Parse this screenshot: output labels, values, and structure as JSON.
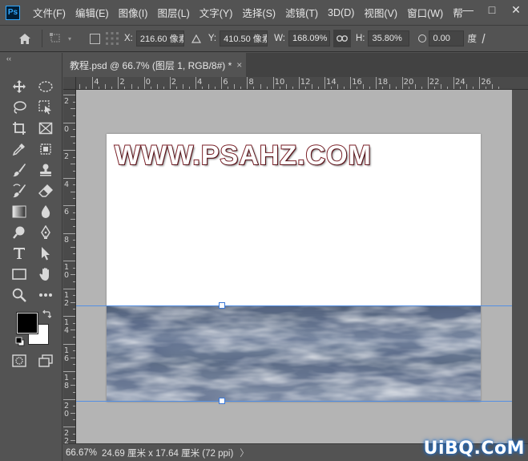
{
  "menubar": {
    "logo": "Ps",
    "items": [
      "文件(F)",
      "编辑(E)",
      "图像(I)",
      "图层(L)",
      "文字(Y)",
      "选择(S)",
      "滤镜(T)",
      "3D(D)",
      "视图(V)",
      "窗口(W)",
      "帮"
    ],
    "window_buttons": {
      "minimize": "—",
      "maximize": "□",
      "close": "✕"
    }
  },
  "options": {
    "x_label": "X:",
    "x_value": "216.60 像素",
    "y_label": "Y:",
    "y_value": "410.50 像素",
    "w_label": "W:",
    "w_value": "168.09%",
    "h_label": "H:",
    "h_value": "35.80%",
    "angle_value": "0.00",
    "angle_unit": "度"
  },
  "toolbar": {
    "collapse": "‹‹"
  },
  "tab": {
    "title": "教程.psd @ 66.7% (图层 1, RGB/8#) *",
    "close": "×"
  },
  "rulers": {
    "h_labels": [
      "6",
      "4",
      "2",
      "0",
      "2",
      "4",
      "6",
      "8",
      "10",
      "12",
      "14",
      "16",
      "18",
      "20",
      "22",
      "24",
      "26"
    ],
    "v_labels": [
      "2",
      "0",
      "2",
      "4",
      "6",
      "8",
      "1\n0",
      "1\n2",
      "1\n4",
      "1\n6",
      "1\n8",
      "2\n0",
      "2\n2"
    ]
  },
  "canvas": {
    "title_text": "WWW.PSAHZ.COM"
  },
  "status": {
    "zoom": "66.67%",
    "doc_size": "24.69 厘米 x 17.64 厘米 (72 ppi)",
    "arrow": "〉"
  },
  "watermark": "UiBQ.CoM",
  "colors": {
    "foreground": "#000000",
    "background": "#ffffff",
    "guide": "#4a8ce8",
    "text_stroke": "#7a1e25"
  }
}
